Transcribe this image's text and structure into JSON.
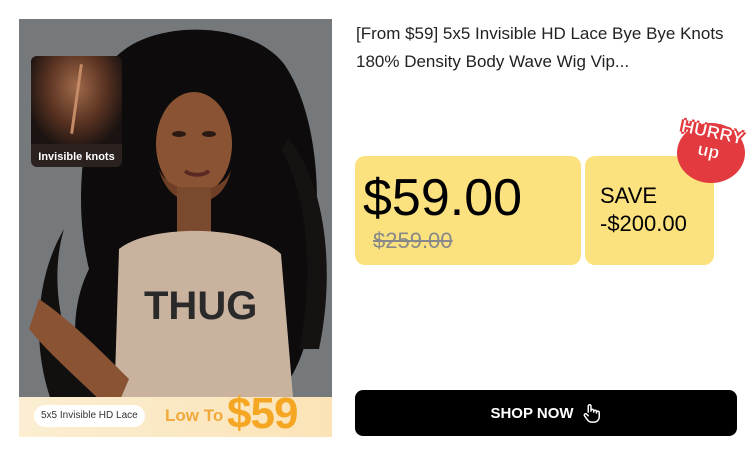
{
  "product": {
    "title": "[From $59] 5x5 Invisible HD Lace Bye Bye Knots 180% Density Body Wave Wig Vip...",
    "image": {
      "inset_label": "Invisible knots",
      "shirt_text": "THUG",
      "pill_label": "5x5 Invisible HD Lace",
      "low_to_label": "Low To",
      "low_to_price": "$59"
    }
  },
  "pricing": {
    "current_price": "$59.00",
    "original_price": "$259.00",
    "save_label": "SAVE",
    "save_amount": "-$200.00"
  },
  "badge": {
    "line1": "HURRY",
    "line2": "up"
  },
  "cta": {
    "label": "SHOP NOW",
    "icon": "hand-pointer-icon"
  },
  "colors": {
    "price_box": "#fbe27f",
    "badge": "#e23a3f",
    "button": "#000000",
    "promo_price": "#f5a623"
  }
}
